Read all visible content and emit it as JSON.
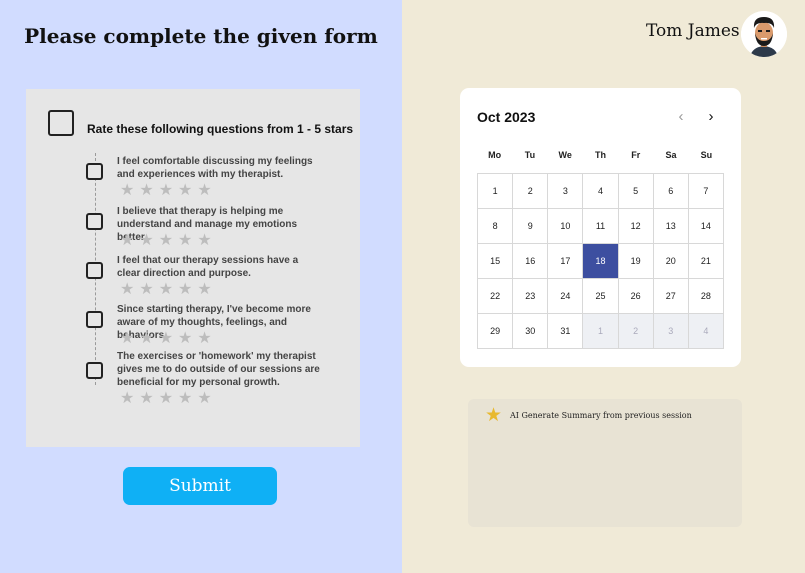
{
  "form": {
    "title": "Please complete the given form",
    "heading": "Rate these following questions from 1 - 5 stars",
    "questions": [
      {
        "text": "I feel comfortable discussing my feelings and experiences with my therapist.",
        "rating": 0
      },
      {
        "text": "I believe that therapy is helping me understand and manage my emotions better.",
        "rating": 0
      },
      {
        "text": "I feel that our therapy sessions have a clear direction and purpose.",
        "rating": 0
      },
      {
        "text": "Since starting therapy, I've become more aware of my thoughts, feelings, and behaviors.",
        "rating": 0
      },
      {
        "text": "The exercises or 'homework' my therapist gives me to do outside of our sessions are beneficial for my personal growth.",
        "rating": 0
      }
    ],
    "star_glyph": "★",
    "submit_label": "Submit"
  },
  "user": {
    "name": "Tom James"
  },
  "calendar": {
    "month_label": "Oct 2023",
    "prev_icon": "‹",
    "next_icon": "›",
    "weekdays": [
      "Mo",
      "Tu",
      "We",
      "Th",
      "Fr",
      "Sa",
      "Su"
    ],
    "days": [
      "1",
      "2",
      "3",
      "4",
      "5",
      "6",
      "7",
      "8",
      "9",
      "10",
      "11",
      "12",
      "13",
      "14",
      "15",
      "16",
      "17",
      "18",
      "19",
      "20",
      "21",
      "22",
      "23",
      "24",
      "25",
      "26",
      "27",
      "28",
      "29",
      "30",
      "31",
      "1",
      "2",
      "3",
      "4"
    ],
    "selected_day": "18",
    "trailing_next_month_count": 4
  },
  "ai_summary": {
    "icon": "★",
    "label": "AI Generate Summary from previous session"
  },
  "colors": {
    "left_bg": "#d1dcff",
    "right_bg": "#f0ead7",
    "submit": "#0fb0f5",
    "selected_day": "#3d4fa0",
    "star_accent": "#e8b92f"
  }
}
